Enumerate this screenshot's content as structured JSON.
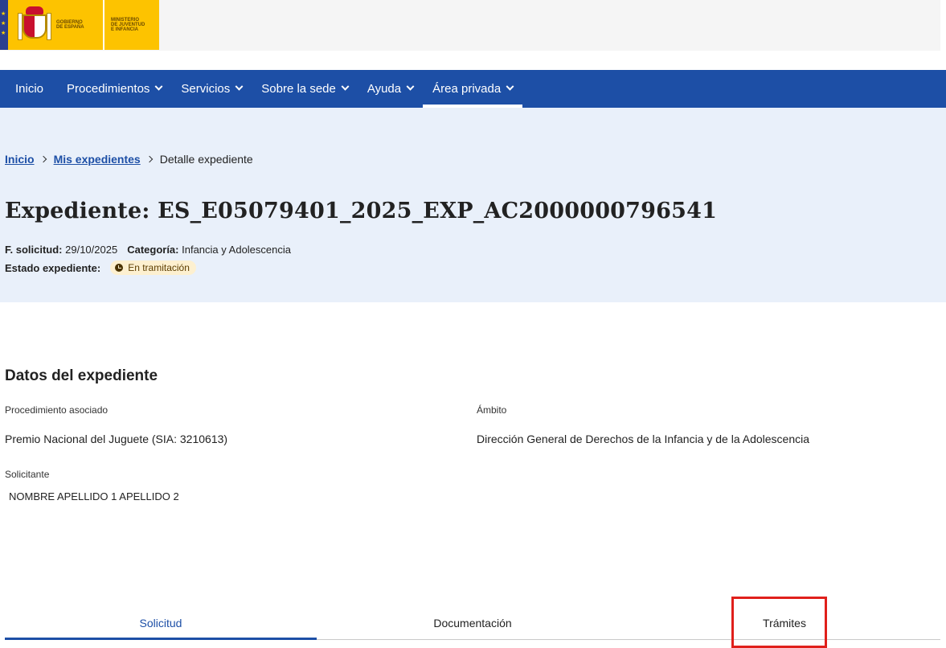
{
  "logo": {
    "line1": "GOBIERNO",
    "line2": "DE ESPAÑA",
    "min1": "MINISTERIO",
    "min2": "DE JUVENTUD",
    "min3": "E INFANCIA"
  },
  "nav": {
    "items": [
      {
        "label": "Inicio"
      },
      {
        "label": "Procedimientos"
      },
      {
        "label": "Servicios"
      },
      {
        "label": "Sobre la sede"
      },
      {
        "label": "Ayuda"
      },
      {
        "label": "Área privada"
      }
    ]
  },
  "breadcrumb": {
    "home": "Inicio",
    "parent": "Mis expedientes",
    "current": "Detalle expediente"
  },
  "header": {
    "title": "Expediente: ES_E05079401_2025_EXP_AC2000000796541",
    "fecha_label": "F. solicitud:",
    "fecha_value": "29/10/2025",
    "categoria_label": "Categoría:",
    "categoria_value": "Infancia y Adolescencia",
    "estado_label": "Estado expediente:",
    "estado_value": "En tramitación"
  },
  "datos": {
    "title": "Datos del expediente",
    "procedimiento_label": "Procedimiento asociado",
    "procedimiento_value": "Premio Nacional del Juguete (SIA: 3210613)",
    "ambito_label": "Ámbito",
    "ambito_value": "Dirección General de Derechos de la Infancia y de la Adolescencia",
    "solicitante_label": "Solicitante",
    "solicitante_value": "NOMBRE APELLIDO 1 APELLIDO 2"
  },
  "tabs": [
    {
      "label": "Solicitud"
    },
    {
      "label": "Documentación"
    },
    {
      "label": "Trámites"
    }
  ],
  "colors": {
    "primary": "#1d4fa6",
    "hero_bg": "#e9f0fa",
    "highlight": "#e0201b",
    "badge_bg": "#fdf0d0"
  }
}
